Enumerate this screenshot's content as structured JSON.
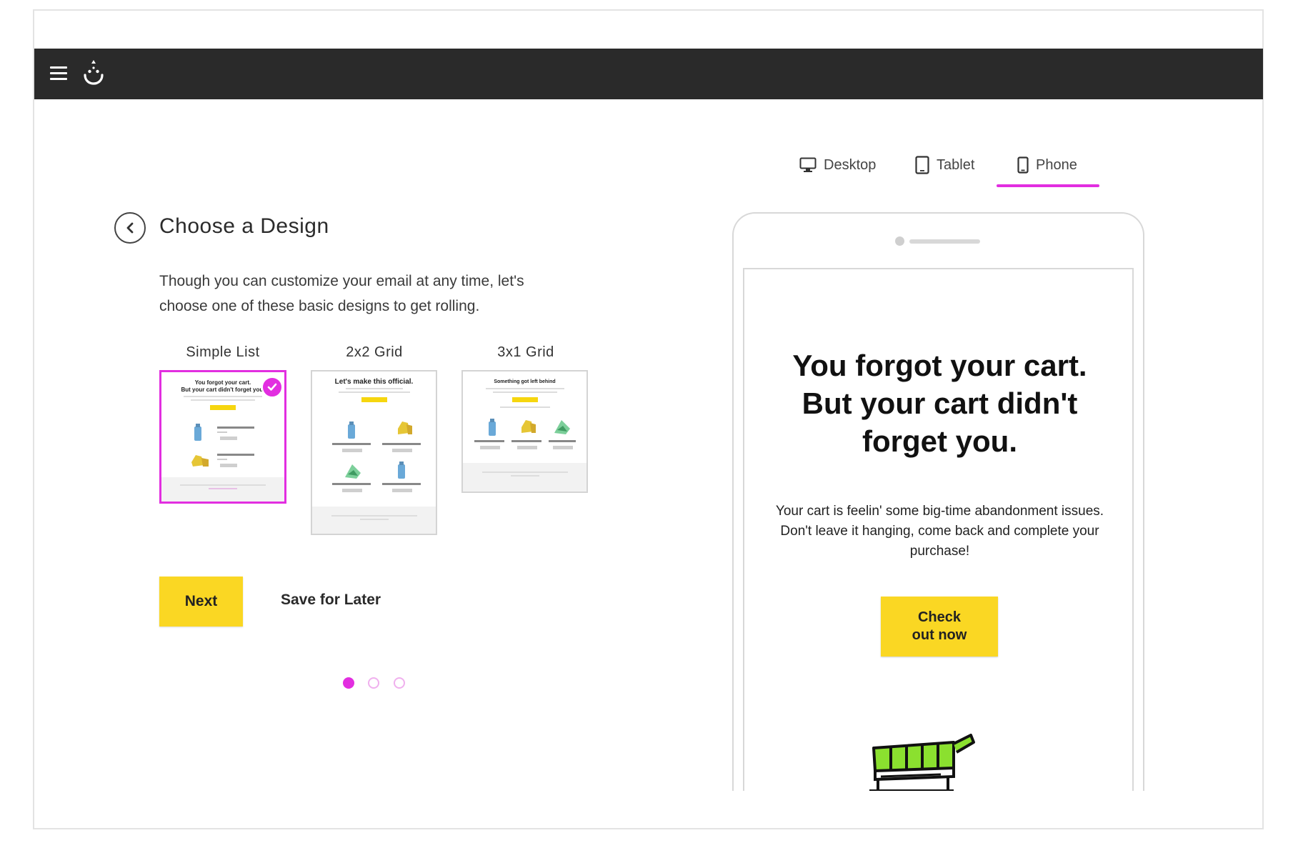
{
  "header": {
    "menu_icon": "hamburger-menu-icon",
    "logo_icon": "smiley-logo-icon",
    "bar_color": "#2a2a2a"
  },
  "device_tabs": [
    {
      "label": "Desktop",
      "icon": "desktop-icon"
    },
    {
      "label": "Tablet",
      "icon": "tablet-icon"
    },
    {
      "label": "Phone",
      "icon": "phone-icon",
      "active": true
    }
  ],
  "main": {
    "title": "Choose a Design",
    "intro_line1": "Though you can customize your email at any time, let's",
    "intro_line2": "choose one of these basic designs to get rolling.",
    "designs": [
      {
        "label": "Simple List",
        "selected": true,
        "thumb_heading_1": "You forgot your cart.",
        "thumb_heading_2": "But your cart didn't forget you."
      },
      {
        "label": "2x2 Grid",
        "selected": false,
        "thumb_heading_1": "Let's make this official."
      },
      {
        "label": "3x1 Grid",
        "selected": false,
        "thumb_heading_1": "Something got left behind"
      }
    ],
    "next_label": "Next",
    "save_later_label": "Save for Later",
    "pagination": {
      "current": 1,
      "total": 3
    }
  },
  "preview": {
    "headline_line1": "You forgot your cart.",
    "headline_line2": "But your cart didn't",
    "headline_line3": "forget you.",
    "body_line1": "Your cart is feelin' some big-time abandonment issues.",
    "body_line2": "Don't leave it hanging, come back and complete your",
    "body_line3": "purchase!",
    "cta_line1": "Check",
    "cta_line2": "out now"
  },
  "colors": {
    "accent": "#e22ee0",
    "button": "#fad723",
    "cart_green": "#8be02f"
  }
}
